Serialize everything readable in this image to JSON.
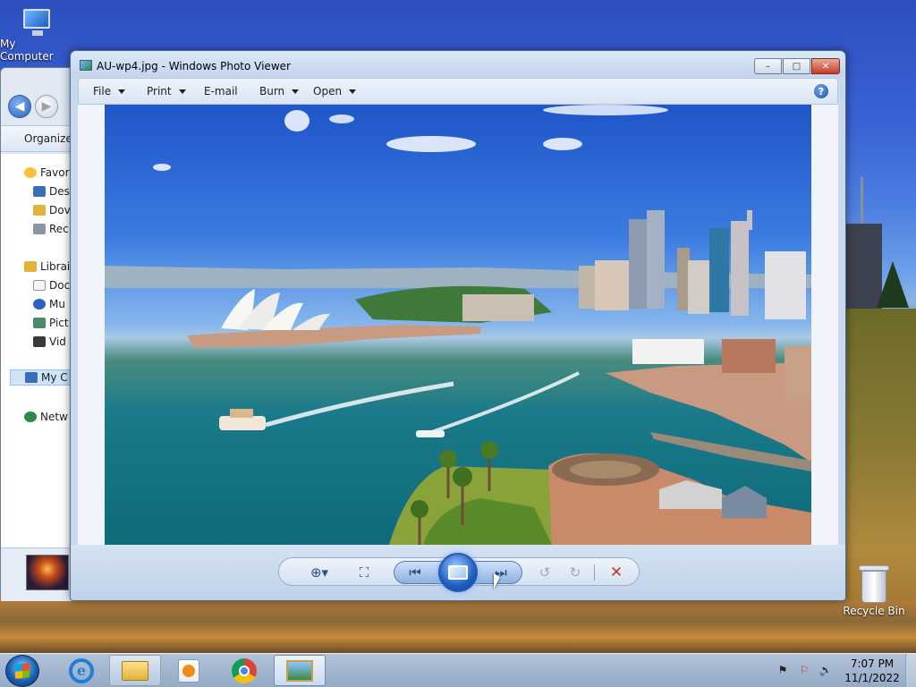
{
  "desktop": {
    "icons": [
      {
        "label": "My Computer",
        "icon": "computer-icon"
      },
      {
        "label": "Recycle Bin",
        "icon": "recycle-bin-icon"
      }
    ]
  },
  "explorer": {
    "toolbar_label": "Organize",
    "tree": [
      {
        "label": "Favorites",
        "icon": "star-icon"
      },
      {
        "label": "Desktop",
        "icon": "desktop-icon"
      },
      {
        "label": "Downloads",
        "icon": "downloads-icon"
      },
      {
        "label": "Recent Places",
        "icon": "recent-icon"
      },
      {
        "label": "Libraries",
        "icon": "library-icon"
      },
      {
        "label": "Documents",
        "icon": "documents-icon"
      },
      {
        "label": "Music",
        "icon": "music-icon"
      },
      {
        "label": "Pictures",
        "icon": "pictures-icon"
      },
      {
        "label": "Videos",
        "icon": "videos-icon"
      },
      {
        "label": "My Computer",
        "icon": "computer-icon"
      },
      {
        "label": "Network",
        "icon": "network-icon"
      }
    ],
    "tree_visible": [
      "Favor",
      "Des",
      "Dov",
      "Rec",
      "Librai",
      "Doc",
      "Mu",
      "Pict",
      "Vid",
      "My C",
      "Netw"
    ]
  },
  "photo_viewer": {
    "title": "AU-wp4.jpg - Windows Photo Viewer",
    "menu": [
      {
        "label": "File",
        "has_dropdown": true
      },
      {
        "label": "Print",
        "has_dropdown": true
      },
      {
        "label": "E-mail",
        "has_dropdown": false
      },
      {
        "label": "Burn",
        "has_dropdown": true
      },
      {
        "label": "Open",
        "has_dropdown": true
      }
    ],
    "help_label": "?",
    "window_buttons": {
      "minimize": "–",
      "maximize": "□",
      "close": "✕"
    },
    "toolbar": {
      "zoom": "zoom-icon",
      "actual_size": "fit-to-window-icon",
      "previous": "previous-icon",
      "slideshow": "slideshow-icon",
      "next": "next-icon",
      "rotate_ccw": "rotate-counterclockwise-icon",
      "rotate_cw": "rotate-clockwise-icon",
      "delete": "delete-icon"
    },
    "image_subject": "Sydney Harbour with Opera House"
  },
  "taskbar": {
    "apps": [
      "start-icon",
      "internet-explorer-icon",
      "windows-explorer-icon",
      "media-player-icon",
      "chrome-icon",
      "photo-viewer-icon"
    ],
    "clock_time": "7:07 PM",
    "clock_date": "11/1/2022"
  },
  "colors": {
    "accent": "#2a64c0",
    "close_button": "#c73a22",
    "delete": "#c8322a"
  }
}
